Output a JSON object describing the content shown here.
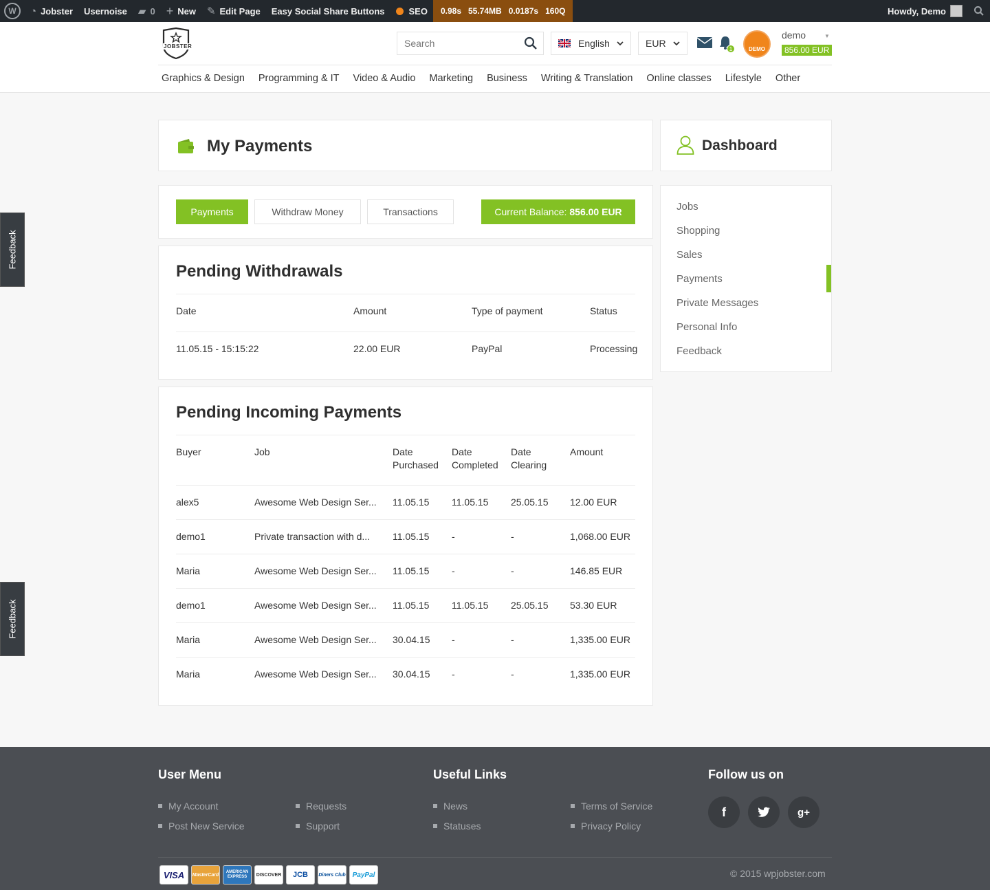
{
  "adminbar": {
    "site": "Jobster",
    "usernoise": "Usernoise",
    "comments": "0",
    "new": "New",
    "edit_page": "Edit Page",
    "share": "Easy Social Share Buttons",
    "seo": "SEO",
    "perf": [
      "0.98s",
      "55.74MB",
      "0.0187s",
      "160Q"
    ],
    "howdy": "Howdy, Demo"
  },
  "header": {
    "logo_text": "JOBSTER",
    "search_placeholder": "Search",
    "language": "English",
    "currency": "EUR",
    "notifications": "1",
    "avatar_text": "DEMO",
    "username": "demo",
    "balance": "856.00 EUR"
  },
  "categories": [
    "Graphics & Design",
    "Programming & IT",
    "Video & Audio",
    "Marketing",
    "Business",
    "Writing & Translation",
    "Online classes",
    "Lifestyle",
    "Other"
  ],
  "feedback_label": "Feedback",
  "page": {
    "title": "My Payments",
    "tabs": [
      "Payments",
      "Withdraw Money",
      "Transactions"
    ],
    "balance_label": "Current Balance:",
    "balance_value": "856.00 EUR"
  },
  "withdrawals": {
    "title": "Pending Withdrawals",
    "headers": [
      "Date",
      "Amount",
      "Type of payment",
      "Status"
    ],
    "rows": [
      [
        "11.05.15 - 15:15:22",
        "22.00 EUR",
        "PayPal",
        "Processing"
      ]
    ]
  },
  "incoming": {
    "title": "Pending Incoming Payments",
    "headers": [
      "Buyer",
      "Job",
      "Date Purchased",
      "Date Completed",
      "Date Clearing",
      "Amount"
    ],
    "rows": [
      [
        "alex5",
        "Awesome Web Design Ser...",
        "11.05.15",
        "11.05.15",
        "25.05.15",
        "12.00 EUR"
      ],
      [
        "demo1",
        "Private transaction with d...",
        "11.05.15",
        "-",
        "-",
        "1,068.00 EUR"
      ],
      [
        "Maria",
        "Awesome Web Design Ser...",
        "11.05.15",
        "-",
        "-",
        "146.85 EUR"
      ],
      [
        "demo1",
        "Awesome Web Design Ser...",
        "11.05.15",
        "11.05.15",
        "25.05.15",
        "53.30 EUR"
      ],
      [
        "Maria",
        "Awesome Web Design Ser...",
        "30.04.15",
        "-",
        "-",
        "1,335.00 EUR"
      ],
      [
        "Maria",
        "Awesome Web Design Ser...",
        "30.04.15",
        "-",
        "-",
        "1,335.00 EUR"
      ]
    ]
  },
  "sidebar": {
    "title": "Dashboard",
    "items": [
      "Jobs",
      "Shopping",
      "Sales",
      "Payments",
      "Private Messages",
      "Personal Info",
      "Feedback"
    ],
    "active": "Payments"
  },
  "footer": {
    "user_menu_title": "User Menu",
    "user_menu": [
      "My Account",
      "Requests",
      "Post New Service",
      "Support"
    ],
    "useful_title": "Useful Links",
    "useful": [
      "News",
      "Terms of Service",
      "Statuses",
      "Privacy Policy"
    ],
    "follow_title": "Follow us on",
    "social": [
      "f",
      "twitter",
      "g+"
    ],
    "cards": [
      "VISA",
      "MasterCard",
      "AMERICAN EXPRESS",
      "DISCOVER",
      "JCB",
      "Diners Club",
      "PayPal"
    ],
    "copyright": "© 2015 wpjobster.com"
  },
  "colors": {
    "accent": "#83c124",
    "adminbar": "#23282d",
    "footer": "#4b4e53",
    "avatar": "#f0851b"
  }
}
